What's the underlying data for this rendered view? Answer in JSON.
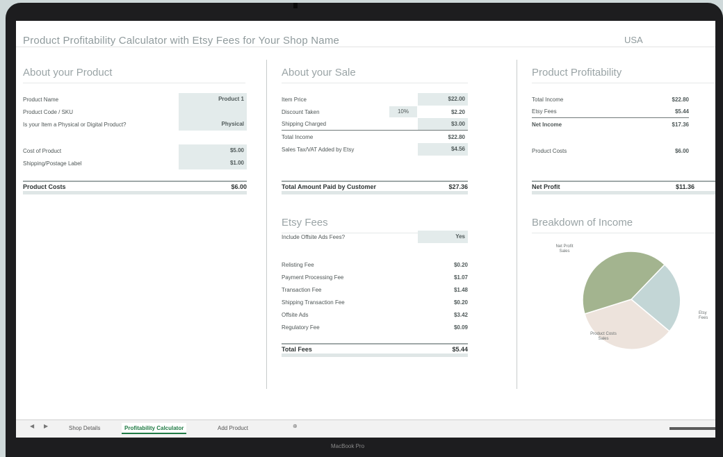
{
  "window": {
    "title": "Product Profitability Calculator with Etsy Fees for Your Shop Name",
    "currency": "USA",
    "device_label": "MacBook Pro"
  },
  "product": {
    "heading": "About your Product",
    "rows": [
      {
        "label": "Product Name",
        "value": "Product 1"
      },
      {
        "label": "Product Code / SKU",
        "value": ""
      },
      {
        "label": "Is your Item a Physical or Digital Product?",
        "value": "Physical"
      },
      {
        "label": "Cost of Product",
        "value": "$5.00"
      },
      {
        "label": "Shipping/Postage Label",
        "value": "$1.00"
      }
    ],
    "total_label": "Product Costs",
    "total_value": "$6.00"
  },
  "sale": {
    "heading": "About your Sale",
    "rows": [
      {
        "label": "Item Price",
        "value": "$22.00"
      },
      {
        "label": "Discount Taken",
        "pct": "10%",
        "value": "$2.20"
      },
      {
        "label": "Shipping Charged",
        "value": "$3.00"
      },
      {
        "label": "Total Income",
        "value": "$22.80"
      },
      {
        "label": "Sales Tax/VAT Added by Etsy",
        "value": "$4.56"
      }
    ],
    "total_label": "Total Amount Paid by Customer",
    "total_value": "$27.36"
  },
  "fees": {
    "heading": "Etsy Fees",
    "offsite_label": "Include Offsite Ads Fees?",
    "offsite_value": "Yes",
    "rows": [
      {
        "label": "Relisting Fee",
        "value": "$0.20"
      },
      {
        "label": "Payment Processing Fee",
        "value": "$1.07"
      },
      {
        "label": "Transaction Fee",
        "value": "$1.48"
      },
      {
        "label": "Shipping Transaction Fee",
        "value": "$0.20"
      },
      {
        "label": "Offsite Ads",
        "value": "$3.42"
      },
      {
        "label": "Regulatory Fee",
        "value": "$0.09"
      }
    ],
    "total_label": "Total Fees",
    "total_value": "$5.44"
  },
  "profitability": {
    "heading": "Product Profitability",
    "rows": [
      {
        "label": "Total Income",
        "value": "$22.80"
      },
      {
        "label": "Etsy Fees",
        "value": "$5.44"
      },
      {
        "label": "Net Income",
        "value": "$17.36"
      },
      {
        "label": "Product Costs",
        "value": "$6.00"
      }
    ],
    "total_label": "Net Profit",
    "total_value": "$11.36"
  },
  "breakdown": {
    "heading": "Breakdown of Income",
    "slice_labels": [
      "Net Profit Sales",
      "Product Costs Sales",
      "Etsy Fees"
    ]
  },
  "sheet_tabs": [
    "Shop Details",
    "Profitability Calculator",
    "Add Product"
  ],
  "colors": {
    "green_slice": "#a3b48f",
    "blue_slice": "#c3d6d6",
    "beige_slice": "#ede3dc",
    "active_tab": "#1e7a43",
    "shaded_input": "#e3ebeb"
  }
}
